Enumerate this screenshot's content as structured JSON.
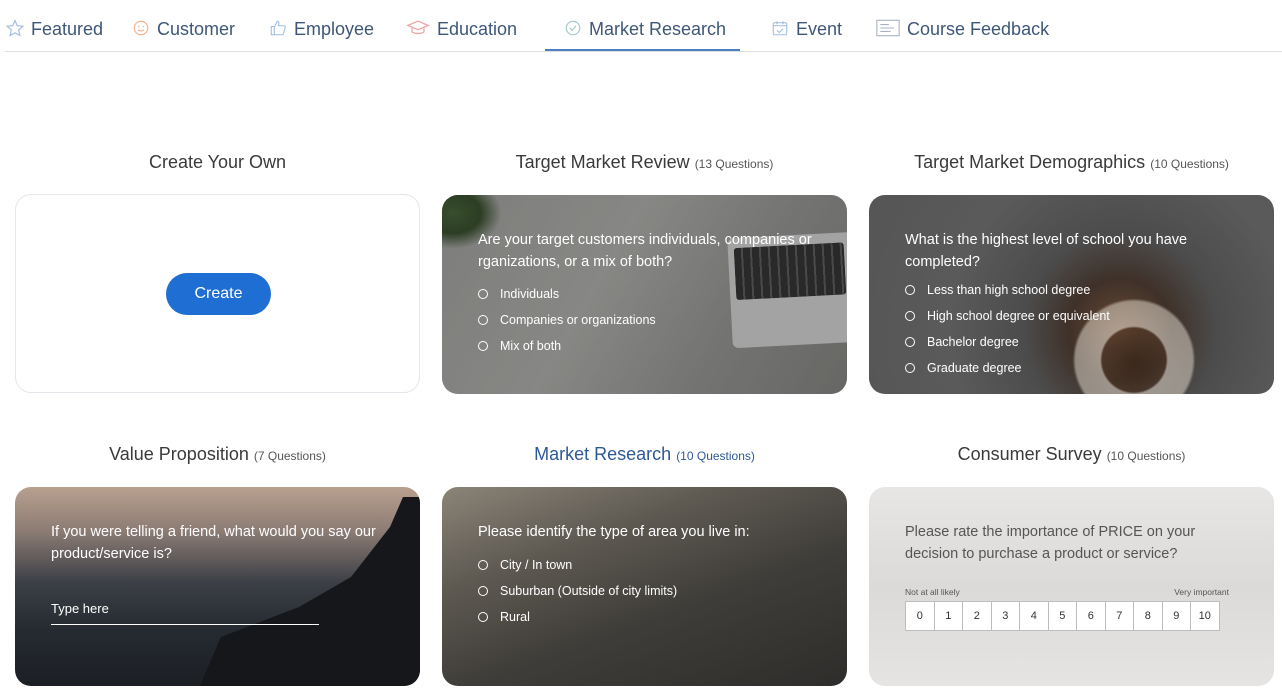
{
  "tabs": [
    {
      "label": "Featured",
      "icon": "star-icon",
      "active": false
    },
    {
      "label": "Customer",
      "icon": "smiley-icon",
      "active": false
    },
    {
      "label": "Employee",
      "icon": "thumbs-up-icon",
      "active": false
    },
    {
      "label": "Education",
      "icon": "graduation-cap-icon",
      "active": false
    },
    {
      "label": "Market Research",
      "icon": "target-icon",
      "active": true
    },
    {
      "label": "Event",
      "icon": "calendar-icon",
      "active": false
    },
    {
      "label": "Course Feedback",
      "icon": "form-icon",
      "active": false
    }
  ],
  "colors": {
    "accent": "#1f6ed4",
    "tab_text": "#3e5779",
    "tab_underline": "#4a7fc1",
    "highlight_title": "#2e5896"
  },
  "cards": {
    "create": {
      "title": "Create Your Own",
      "button": "Create"
    },
    "review": {
      "title": "Target Market Review",
      "count": "(13 Questions)",
      "question": "Are your target customers individuals, companies or rganizations, or a mix of both?",
      "options": [
        "Individuals",
        "Companies or organizations",
        "Mix of both"
      ]
    },
    "demographics": {
      "title": "Target Market Demographics",
      "count": "(10 Questions)",
      "question": "What is the highest level of school you have completed?",
      "options": [
        "Less than high school degree",
        "High school degree or equivalent",
        "Bachelor degree",
        "Graduate degree"
      ]
    },
    "value": {
      "title": "Value Proposition",
      "count": "(7 Questions)",
      "question": "If you were telling a friend, what would you say our product/service is?",
      "placeholder": "Type here"
    },
    "market": {
      "title": "Market Research",
      "count": "(10 Questions)",
      "question": "Please identify the type of area you live in:",
      "options": [
        "City / In town",
        "Suburban (Outside of city limits)",
        "Rural"
      ]
    },
    "consumer": {
      "title": "Consumer Survey",
      "count": "(10 Questions)",
      "question": "Please rate the importance of PRICE on your decision to purchase a product or service?",
      "scale_low": "Not at all likely",
      "scale_high": "Very important",
      "scale": [
        "0",
        "1",
        "2",
        "3",
        "4",
        "5",
        "6",
        "7",
        "8",
        "9",
        "10"
      ]
    }
  }
}
